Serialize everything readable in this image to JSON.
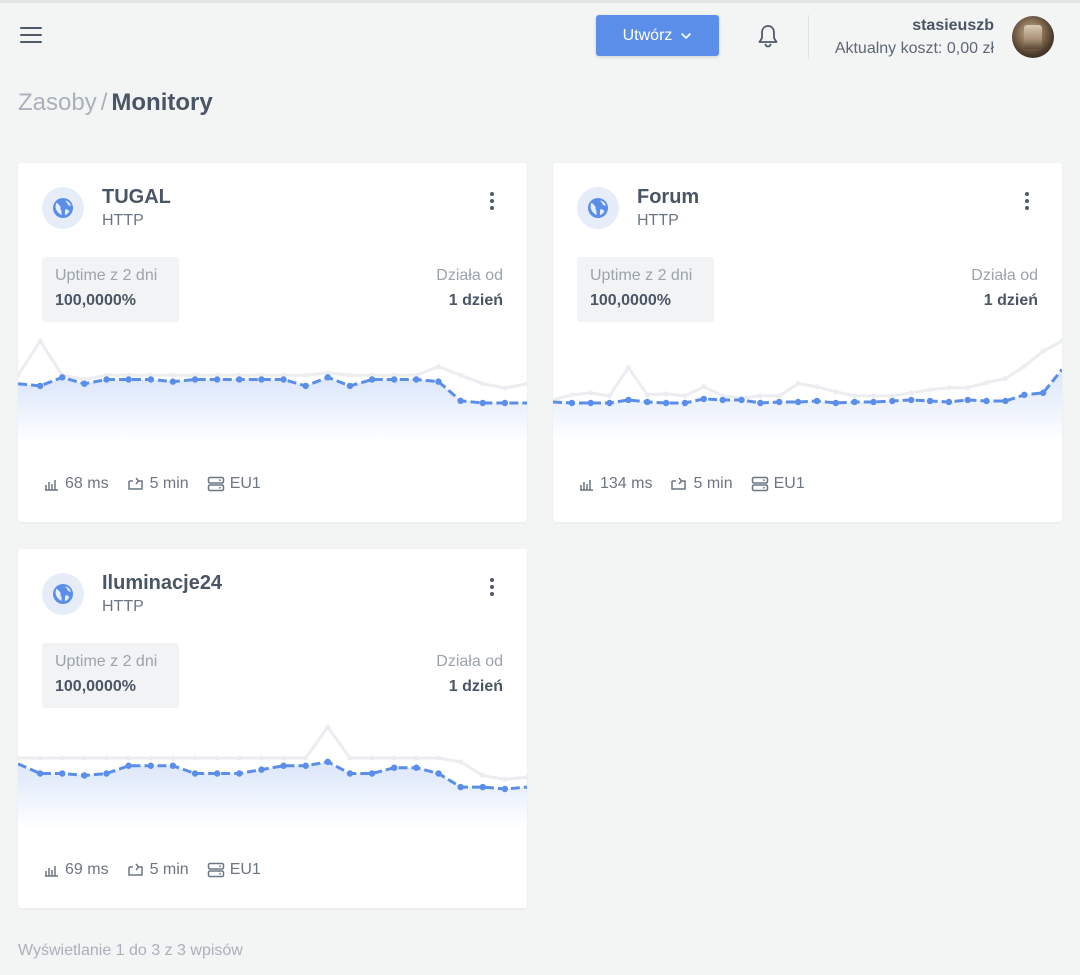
{
  "header": {
    "create_label": "Utwórz",
    "user_name": "stasieuszb",
    "user_cost": "Aktualny koszt: 0,00 zł"
  },
  "breadcrumb": {
    "parent": "Zasoby",
    "separator": "/",
    "current": "Monitory"
  },
  "monitors": [
    {
      "name": "TUGAL",
      "type": "HTTP",
      "uptime_label": "Uptime z 2 dni",
      "uptime_value": "100,0000%",
      "since_label": "Działa od",
      "since_value": "1 dzień",
      "response": "68 ms",
      "interval": "5 min",
      "region": "EU1",
      "series": [
        68,
        69,
        65,
        68,
        66,
        66,
        66,
        67,
        66,
        66,
        66,
        66,
        66,
        69,
        65,
        69,
        66,
        66,
        66,
        67,
        76,
        77,
        77,
        77
      ],
      "series_prev": [
        64,
        48,
        64,
        66,
        64,
        64,
        64,
        64,
        64,
        64,
        64,
        64,
        64,
        64,
        63,
        64,
        64,
        64,
        64,
        60,
        64,
        68,
        70,
        68
      ]
    },
    {
      "name": "Forum",
      "type": "HTTP",
      "uptime_label": "Uptime z 2 dni",
      "uptime_value": "100,0000%",
      "since_label": "Działa od",
      "since_value": "1 dzień",
      "response": "134 ms",
      "interval": "5 min",
      "region": "EU1",
      "series": [
        130,
        131,
        131,
        131,
        128,
        130,
        131,
        131,
        127,
        128,
        128,
        131,
        130,
        130,
        129,
        131,
        130,
        130,
        129,
        128,
        129,
        130,
        128,
        129,
        129,
        123,
        121,
        98
      ],
      "series_prev": [
        128,
        123,
        121,
        124,
        96,
        123,
        122,
        124,
        115,
        124,
        126,
        124,
        124,
        112,
        115,
        120,
        124,
        124,
        124,
        121,
        118,
        116,
        116,
        111,
        107,
        95,
        80,
        70
      ]
    },
    {
      "name": "Iluminacje24",
      "type": "HTTP",
      "uptime_label": "Uptime z 2 dni",
      "uptime_value": "100,0000%",
      "since_label": "Działa od",
      "since_value": "1 dzień",
      "response": "69 ms",
      "interval": "5 min",
      "region": "EU1",
      "series": [
        64,
        69,
        69,
        70,
        69,
        65,
        65,
        65,
        69,
        69,
        69,
        67,
        65,
        65,
        63,
        69,
        69,
        66,
        66,
        69,
        76,
        76,
        77,
        76
      ],
      "series_prev": [
        61,
        61,
        61,
        61,
        61,
        61,
        61,
        61,
        61,
        61,
        61,
        61,
        61,
        61,
        45,
        61,
        61,
        61,
        61,
        61,
        63,
        70,
        72,
        71
      ]
    }
  ],
  "footer": {
    "summary": "Wyświetlanie 1 do 3 z 3 wpisów"
  },
  "colors": {
    "accent": "#5a8ee9",
    "bg": "#f3f4f4"
  },
  "icons": [
    "menu-icon",
    "chevron-down-icon",
    "bell-icon",
    "globe-icon",
    "kebab-icon",
    "bar-chart-icon",
    "repeat-icon",
    "server-icon"
  ]
}
